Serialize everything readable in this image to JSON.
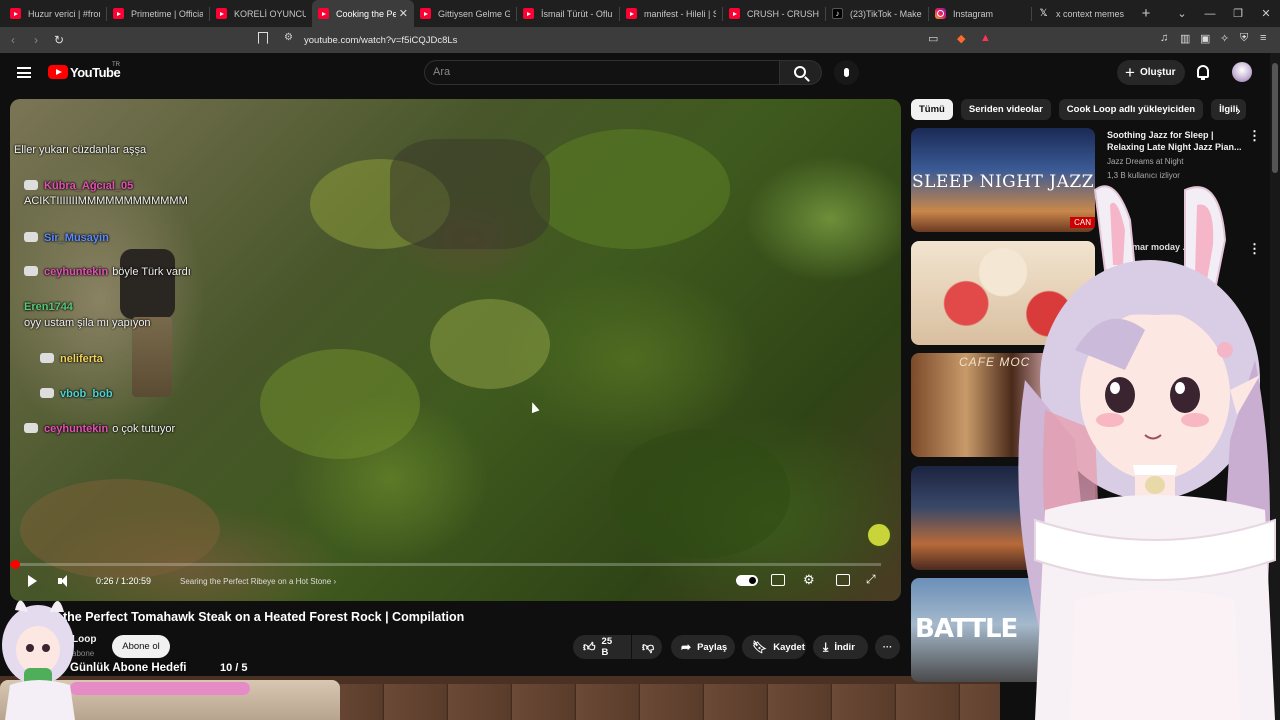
{
  "tabs": [
    {
      "title": "Huzur verici | #fron",
      "icon": "youtube"
    },
    {
      "title": "Primetime | Official",
      "icon": "youtube"
    },
    {
      "title": "KORELİ OYUNCUDA",
      "icon": "youtube"
    },
    {
      "title": "Cooking the Pe",
      "icon": "youtube",
      "active": true,
      "close": "✕"
    },
    {
      "title": "Gittiysen Gelme Ge",
      "icon": "youtube"
    },
    {
      "title": "İsmail Türüt - Oflu",
      "icon": "youtube"
    },
    {
      "title": "manifest - Hileli | S",
      "icon": "youtube"
    },
    {
      "title": "CRUSH - CRUSH! |",
      "icon": "youtube"
    },
    {
      "title": "(23)TikTok - Make Y",
      "icon": "tiktok"
    },
    {
      "title": "Instagram",
      "icon": "instagram"
    },
    {
      "title": "x context memes",
      "icon": "x"
    }
  ],
  "newtab": "+",
  "window_controls": [
    "⌄",
    "—",
    "❐",
    "✕"
  ],
  "address": {
    "url": "youtube.com/watch?v=f5iCQJDc8Ls"
  },
  "yt": {
    "logo_text": "YouTube",
    "logo_sup": "TR",
    "search_placeholder": "Ara",
    "create_label": "Oluştur",
    "create_plus": "+"
  },
  "chat": [
    {
      "user": "",
      "text": "Eller yukarı cüzdanlar aşşa",
      "top": "e1"
    },
    {
      "user": "Kübra_Ağcıal_05",
      "text": "",
      "color": "#e64fb5"
    },
    {
      "user": "",
      "text": "ACIKTIIIIIIIMMMMMMMMMMMM"
    },
    {
      "user": "Sir_Musayin",
      "text": "",
      "color": "#5b8cff"
    },
    {
      "user": "ceyhuntekin",
      "text": "böyle Türk vardı",
      "color": "#e64fb5"
    },
    {
      "user": "Eren1744",
      "text": "",
      "color": "#59c77a"
    },
    {
      "user": "",
      "text": "oyy ustam şila mı yapıyon"
    },
    {
      "user": "neliferta",
      "text": "",
      "color": "#f2d45c"
    },
    {
      "user": "vbob_bob",
      "text": "",
      "color": "#4bd3d3"
    },
    {
      "user": "ceyhuntekin",
      "text": "o çok tutuyor",
      "color": "#e64fb5"
    }
  ],
  "player": {
    "time": "0:26 / 1:20:59",
    "chapter": "Searing the Perfect Ribeye on a Hot Stone",
    "chapter_arrow": "›",
    "progress": 0.0054
  },
  "video": {
    "title": "the Perfect Tomahawk Steak on a Heated Forest Rock | Compilation",
    "channel": "Loop",
    "subs": "abone",
    "subscribe_label": "Abone ol",
    "like_count": "25 B",
    "share_label": "Paylaş",
    "save_label": "Kaydet",
    "download_label": "İndir",
    "more": "···"
  },
  "goal": {
    "label": "Günlük Abone Hedefi",
    "count": "10 / 5",
    "fraction": 1.0
  },
  "chips": [
    "Tümü",
    "Seriden videolar",
    "Cook Loop adlı yükleyiciden",
    "İlgili"
  ],
  "recommendations": [
    {
      "title": "Soothing Jazz for Sleep | Relaxing Late Night Jazz Pian...",
      "channel": "Jazz Dreams at Night",
      "meta": "1,3 B kullanıcı izliyor",
      "thumb_text": "SLEEP NIGHT JAZZ",
      "badge": "CAN"
    },
    {
      "title": "mar moday ...li",
      "channel": "",
      "meta": "",
      "thumb_text": ""
    },
    {
      "title": "",
      "channel": "",
      "meta": "",
      "thumb_text": "CAFE MOC"
    },
    {
      "title": "",
      "channel": "",
      "meta": "",
      "thumb_text": ""
    },
    {
      "title": "",
      "channel": "",
      "meta": "",
      "thumb_text": "BATTLE"
    }
  ],
  "colors": {
    "accent": "#ff0000",
    "bg": "#0f0f0f",
    "chip_bg": "#272727",
    "goal_bar": "#f3a9d8"
  }
}
